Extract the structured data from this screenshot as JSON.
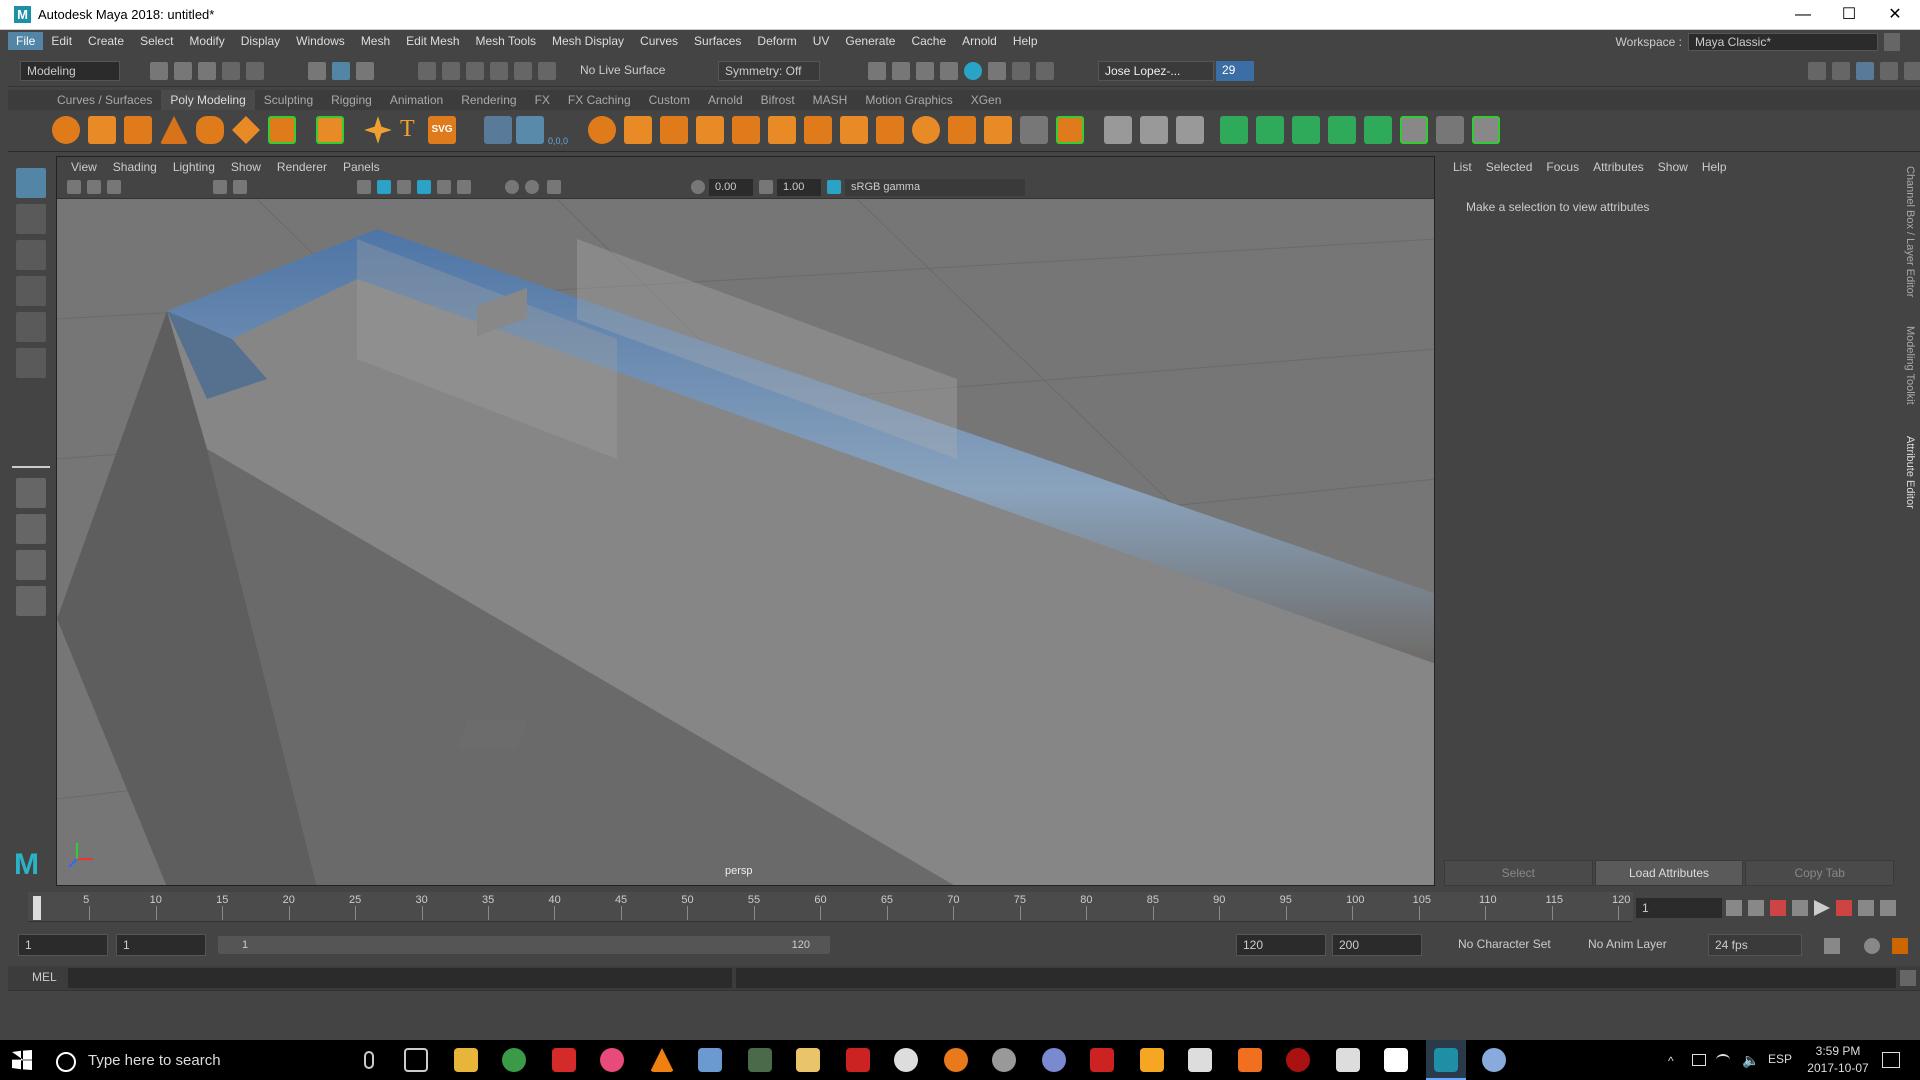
{
  "window": {
    "title": "Autodesk Maya 2018: untitled*",
    "logo_letter": "M"
  },
  "menubar": {
    "items": [
      "File",
      "Edit",
      "Create",
      "Select",
      "Modify",
      "Display",
      "Windows",
      "Mesh",
      "Edit Mesh",
      "Mesh Tools",
      "Mesh Display",
      "Curves",
      "Surfaces",
      "Deform",
      "UV",
      "Generate",
      "Cache",
      "Arnold",
      "Help"
    ]
  },
  "workspace": {
    "label": "Workspace :",
    "value": "Maya Classic*"
  },
  "statusline": {
    "mode": "Modeling",
    "live_surface": "No Live Surface",
    "symmetry": "Symmetry: Off",
    "user": "Jose Lopez-...",
    "notifications": "29"
  },
  "shelf": {
    "tabs": [
      "Curves / Surfaces",
      "Poly Modeling",
      "Sculpting",
      "Rigging",
      "Animation",
      "Rendering",
      "FX",
      "FX Caching",
      "Custom",
      "Arnold",
      "Bifrost",
      "MASH",
      "Motion Graphics",
      "XGen"
    ],
    "active_tab": "Poly Modeling",
    "text_tool": "T",
    "svg_tool": "SVG",
    "coord_label": "0,0,0"
  },
  "viewport": {
    "menu": [
      "View",
      "Shading",
      "Lighting",
      "Show",
      "Renderer",
      "Panels"
    ],
    "exposure": "0.00",
    "gamma": "1.00",
    "colorspace": "sRGB gamma",
    "camera": "persp"
  },
  "attribute_editor": {
    "menu": [
      "List",
      "Selected",
      "Focus",
      "Attributes",
      "Show",
      "Help"
    ],
    "message": "Make a selection to view attributes",
    "buttons": [
      "Select",
      "Load Attributes",
      "Copy Tab"
    ]
  },
  "side_tabs": [
    "Channel Box / Layer Editor",
    "Modeling Toolkit",
    "Attribute Editor"
  ],
  "timeline": {
    "ticks": [
      "1",
      "5",
      "10",
      "15",
      "20",
      "25",
      "30",
      "35",
      "40",
      "45",
      "50",
      "55",
      "60",
      "65",
      "70",
      "75",
      "80",
      "85",
      "90",
      "95",
      "100",
      "105",
      "110",
      "115",
      "120"
    ],
    "current_frame": "1"
  },
  "range": {
    "start": "1",
    "playback_start": "1",
    "slider_start": "1",
    "slider_end": "120",
    "playback_end": "120",
    "end": "200",
    "character_set": "No Character Set",
    "anim_layer": "No Anim Layer",
    "fps": "24 fps"
  },
  "cmdline": {
    "label": "MEL"
  },
  "taskbar": {
    "search_placeholder": "Type here to search",
    "language": "ESP",
    "time": "3:59 PM",
    "date": "2017-10-07"
  }
}
